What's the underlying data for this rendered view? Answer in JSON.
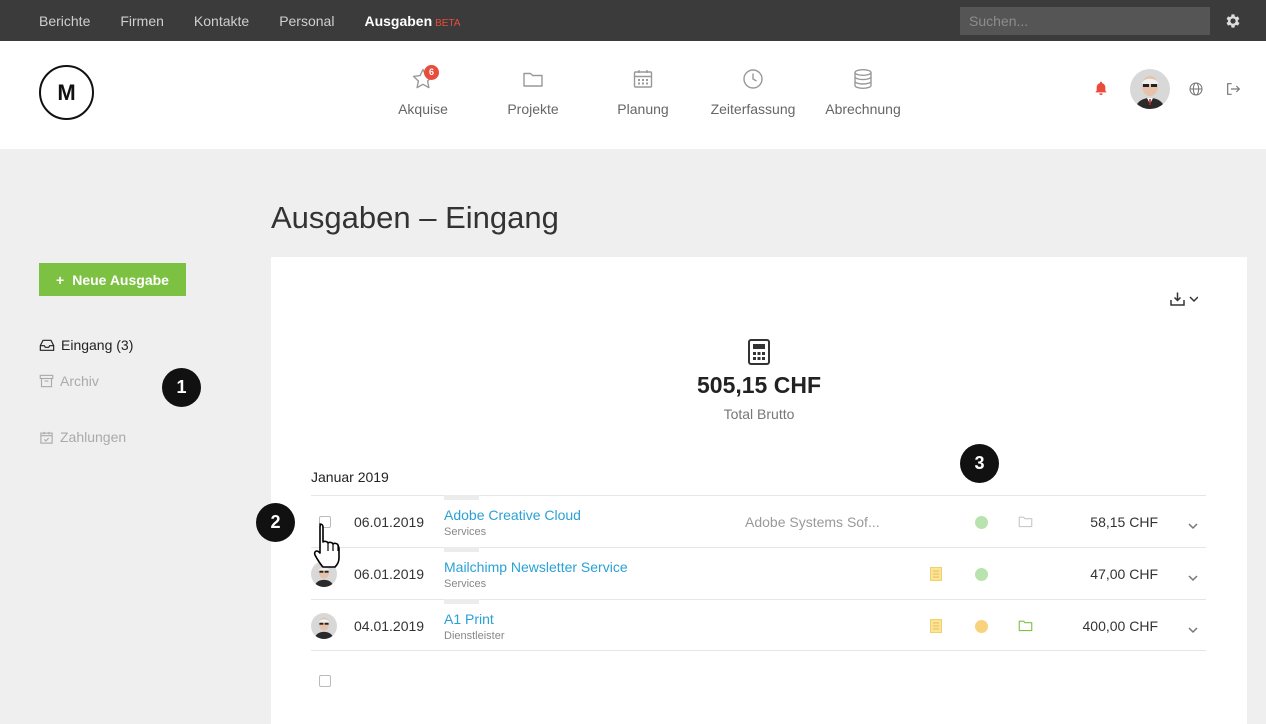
{
  "topbar": {
    "items": [
      {
        "label": "Berichte",
        "active": false
      },
      {
        "label": "Firmen",
        "active": false
      },
      {
        "label": "Kontakte",
        "active": false
      },
      {
        "label": "Personal",
        "active": false
      },
      {
        "label": "Ausgaben",
        "active": true
      }
    ],
    "beta_label": "BETA",
    "search_placeholder": "Suchen...",
    "settings_icon": "gear-icon"
  },
  "header": {
    "logo": "M",
    "nav": [
      {
        "label": "Akquise",
        "icon": "star-icon",
        "badge": "6"
      },
      {
        "label": "Projekte",
        "icon": "folder-icon"
      },
      {
        "label": "Planung",
        "icon": "calendar-icon"
      },
      {
        "label": "Zeiterfassung",
        "icon": "clock-icon"
      },
      {
        "label": "Abrechnung",
        "icon": "database-icon"
      }
    ],
    "notification_color": "#e94b3c"
  },
  "sidebar": {
    "new_button": "Neue Ausgabe",
    "items": [
      {
        "label": "Eingang (3)",
        "icon": "inbox-icon",
        "active": true
      },
      {
        "label": "Archiv",
        "icon": "archive-icon",
        "active": false
      },
      {
        "label": "Zahlungen",
        "icon": "calendar-check-icon",
        "active": false
      }
    ]
  },
  "markers": [
    "1",
    "2",
    "3"
  ],
  "main": {
    "title": "Ausgaben – Eingang",
    "total": "505,15 CHF",
    "total_label": "Total Brutto",
    "month": "Januar 2019",
    "rows": [
      {
        "date": "06.01.2019",
        "name": "Adobe Creative Cloud",
        "category": "Services",
        "vendor": "Adobe Systems Sof...",
        "amount": "58,15 CHF",
        "status_color": "#b9e3ad",
        "doc": false,
        "folder_color": "#c8c8c8"
      },
      {
        "date": "06.01.2019",
        "name": "Mailchimp Newsletter Service",
        "category": "Services",
        "vendor": "",
        "amount": "47,00 CHF",
        "status_color": "#b9e3ad",
        "doc": true,
        "folder_color": ""
      },
      {
        "date": "04.01.2019",
        "name": "A1 Print",
        "category": "Dienstleister",
        "vendor": "",
        "amount": "400,00 CHF",
        "status_color": "#f9d27e",
        "doc": true,
        "folder_color": "#7dc143"
      }
    ]
  },
  "colors": {
    "accent_green": "#7dc143",
    "link_blue": "#2aa1d6",
    "topbar_bg": "#3b3b3b"
  }
}
